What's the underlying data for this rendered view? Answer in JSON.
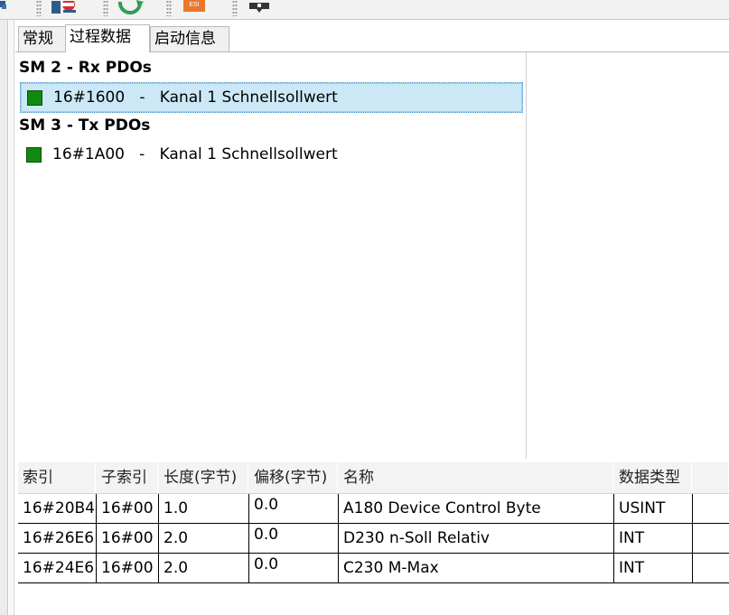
{
  "tabs": [
    {
      "label": "常规",
      "active": false
    },
    {
      "label": "过程数据",
      "active": true
    },
    {
      "label": "启动信息",
      "active": false
    }
  ],
  "toolbar": {
    "icons": [
      "settings-icon",
      "refresh-icon",
      "esi-icon",
      "comment-icon"
    ],
    "esi_label": "ESI"
  },
  "tree": {
    "rx_header": "SM 2 - Rx PDOs",
    "rx_items": [
      {
        "index": "16#1600",
        "separator": "-",
        "name": "Kanal 1 Schnellsollwert",
        "selected": true
      }
    ],
    "tx_header": "SM 3 - Tx PDOs",
    "tx_items": [
      {
        "index": "16#1A00",
        "separator": "-",
        "name": "Kanal 1 Schnellsollwert",
        "selected": false
      }
    ],
    "item_color": "#118a11"
  },
  "table": {
    "columns": [
      "索引",
      "子索引",
      "长度(字节)",
      "偏移(字节)",
      "名称",
      "数据类型"
    ],
    "rows": [
      [
        "16#20B4",
        "16#00",
        "1.0",
        "0.0",
        "A180 Device Control Byte",
        "USINT"
      ],
      [
        "16#26E6",
        "16#00",
        "2.0",
        "0.0",
        "D230 n-Soll Relativ",
        "INT"
      ],
      [
        "16#24E6",
        "16#00",
        "2.0",
        "0.0",
        "C230 M-Max",
        "INT"
      ]
    ]
  },
  "colors": {
    "selection_bg": "#cce8f6",
    "selection_border": "#3a89c9",
    "refresh_green": "#2e9e58",
    "esi_orange": "#e8782a"
  }
}
